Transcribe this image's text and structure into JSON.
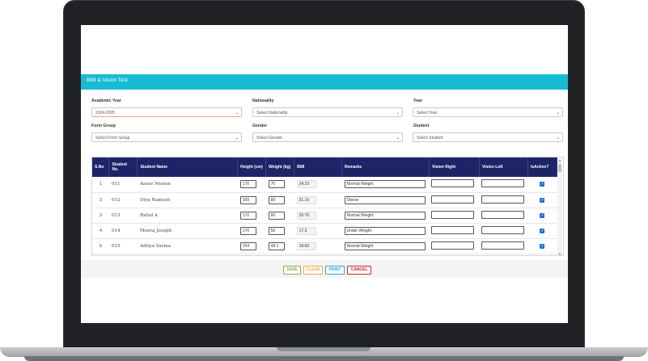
{
  "app": {
    "title": "BMI & Vision Test"
  },
  "filters": {
    "academic_year": {
      "label": "Academic Year",
      "value": "2024-2025"
    },
    "nationality": {
      "label": "Nationality",
      "placeholder": "Select Nationality"
    },
    "year": {
      "label": "Year",
      "placeholder": "Select Year"
    },
    "form_group": {
      "label": "Form Group",
      "placeholder": "Select Form Group"
    },
    "gender": {
      "label": "Gender",
      "placeholder": "Select Gender"
    },
    "student": {
      "label": "Student",
      "placeholder": "Select Student"
    }
  },
  "table": {
    "headers": [
      "S.No",
      "Student No.",
      "Student Name",
      "Height (cm)",
      "Weight (kg)",
      "BMI",
      "Remarks",
      "Vision Right",
      "Vision Left",
      "IsActive?"
    ],
    "rows": [
      {
        "sno": "1",
        "student_no": "011",
        "name": "Aarav Menon",
        "height": "170",
        "weight": "70",
        "bmi": "24.22",
        "remarks": "Normal Weight",
        "vision_right": "",
        "vision_left": "",
        "active": true
      },
      {
        "sno": "2",
        "student_no": "012",
        "name": "Diya Ramesh",
        "height": "169",
        "weight": "89",
        "bmi": "31.16",
        "remarks": "Obese",
        "vision_right": "",
        "vision_left": "",
        "active": true
      },
      {
        "sno": "3",
        "student_no": "013",
        "name": "Rahul k",
        "height": "170",
        "weight": "60",
        "bmi": "20.76",
        "remarks": "Normal Weight",
        "vision_right": "",
        "vision_left": "",
        "active": true
      },
      {
        "sno": "4",
        "student_no": "014",
        "name": "Meera Joseph",
        "height": "170",
        "weight": "50",
        "bmi": "17.3",
        "remarks": "Under Weight",
        "vision_right": "",
        "vision_left": "",
        "active": true
      },
      {
        "sno": "5",
        "student_no": "015",
        "name": "Aditya Varma",
        "height": "154",
        "weight": "44.1",
        "bmi": "18.60",
        "remarks": "Normal Weight",
        "vision_right": "",
        "vision_left": "",
        "active": true
      }
    ]
  },
  "actions": {
    "save": "SAVE",
    "clear": "CLEAR",
    "print": "PRINT",
    "cancel": "CANCEL"
  },
  "colors": {
    "header_bar": "#17bcd4",
    "table_header": "#1d2467",
    "save": "#7cb342",
    "clear": "#e6b04a",
    "print": "#29a9d6",
    "cancel": "#c62828"
  }
}
